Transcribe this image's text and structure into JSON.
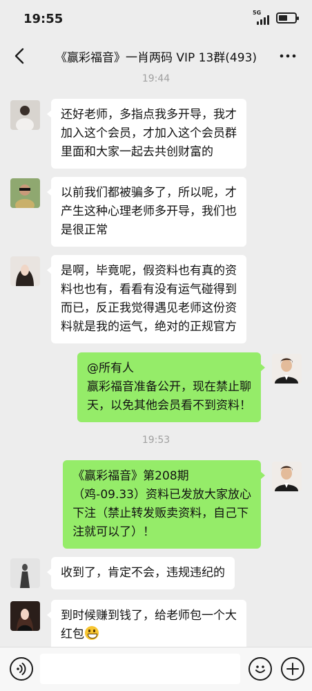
{
  "status_bar": {
    "time": "19:55",
    "network": "5G",
    "battery_level": 0.55
  },
  "nav": {
    "title": "《赢彩福音》一肖两码 VIP 13群(493)",
    "back_icon": "chevron-left-icon",
    "more_icon": "more-dots-icon"
  },
  "timestamps": [
    "19:44",
    "19:53"
  ],
  "messages": [
    {
      "side": "left",
      "lines": [
        "还好老师，多指点我多开导，我才",
        "加入这个会员，才加入这个会员群",
        "里面和大家一起去共创财富的"
      ]
    },
    {
      "side": "left",
      "lines": [
        "以前我们都被骗多了，所以呢，才",
        "产生这种心理老师多开导，我们也",
        "是很正常"
      ]
    },
    {
      "side": "left",
      "lines": [
        "是啊，毕竟呢，假资料也有真的资",
        "料也也有，看看有没有运气碰得到",
        "而已，反正我觉得遇见老师这份资",
        "料就是我的运气，绝对的正规官方"
      ]
    },
    {
      "side": "right",
      "lines": [
        "@所有人",
        "赢彩福音准备公开，现在禁止聊",
        "天，以免其他会员看不到资料！"
      ]
    },
    {
      "side": "right",
      "lines": [
        "《赢彩福音》第208期",
        "（鸡-09.33）资料已发放大家放心",
        "下注（禁止转发贩卖资料，自己下",
        "注就可以了）！"
      ]
    },
    {
      "side": "left",
      "lines": [
        "收到了，肯定不会，违规违纪的"
      ]
    },
    {
      "side": "left",
      "lines": [
        "到时候赚到钱了，给老师包一个大",
        "红包"
      ],
      "emoji": "grinning-face-icon"
    }
  ],
  "input_bar": {
    "voice_icon": "voice-icon",
    "emoji_icon": "smiley-icon",
    "plus_icon": "plus-icon",
    "input_value": ""
  },
  "colors": {
    "background": "#ededed",
    "bubble_left": "#ffffff",
    "bubble_right": "#95ec69"
  }
}
